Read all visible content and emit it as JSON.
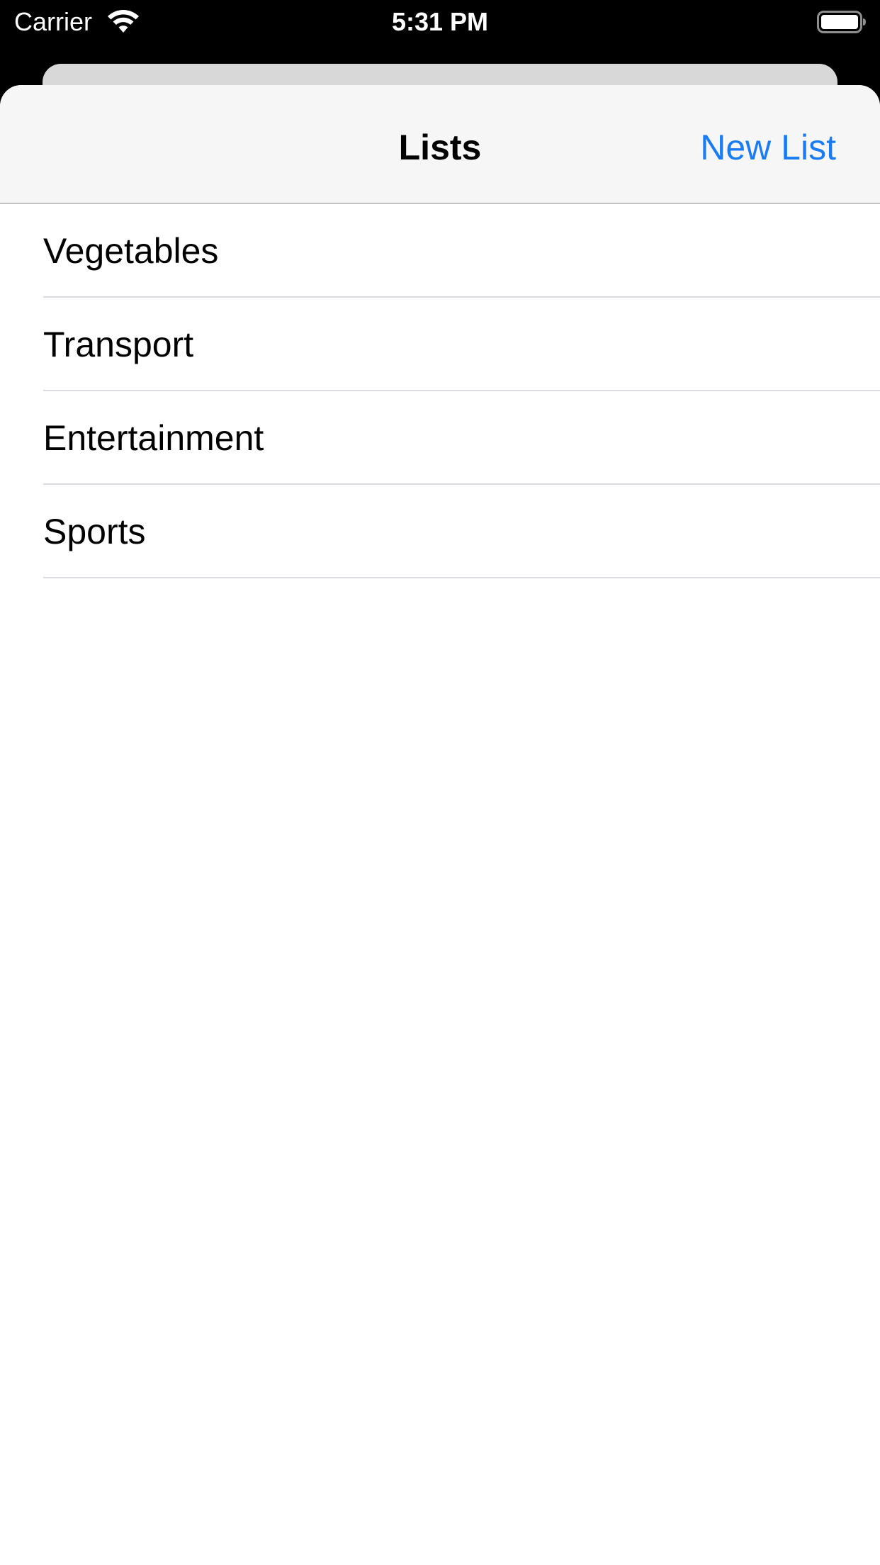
{
  "status_bar": {
    "carrier": "Carrier",
    "time": "5:31 PM",
    "wifi_icon": "wifi-icon",
    "battery_icon": "battery-icon",
    "battery_level": 1.0
  },
  "nav": {
    "title": "Lists",
    "action_label": "New List",
    "action_color": "#1a7cf5"
  },
  "lists": [
    {
      "label": "Vegetables"
    },
    {
      "label": "Transport"
    },
    {
      "label": "Entertainment"
    },
    {
      "label": "Sports"
    }
  ]
}
